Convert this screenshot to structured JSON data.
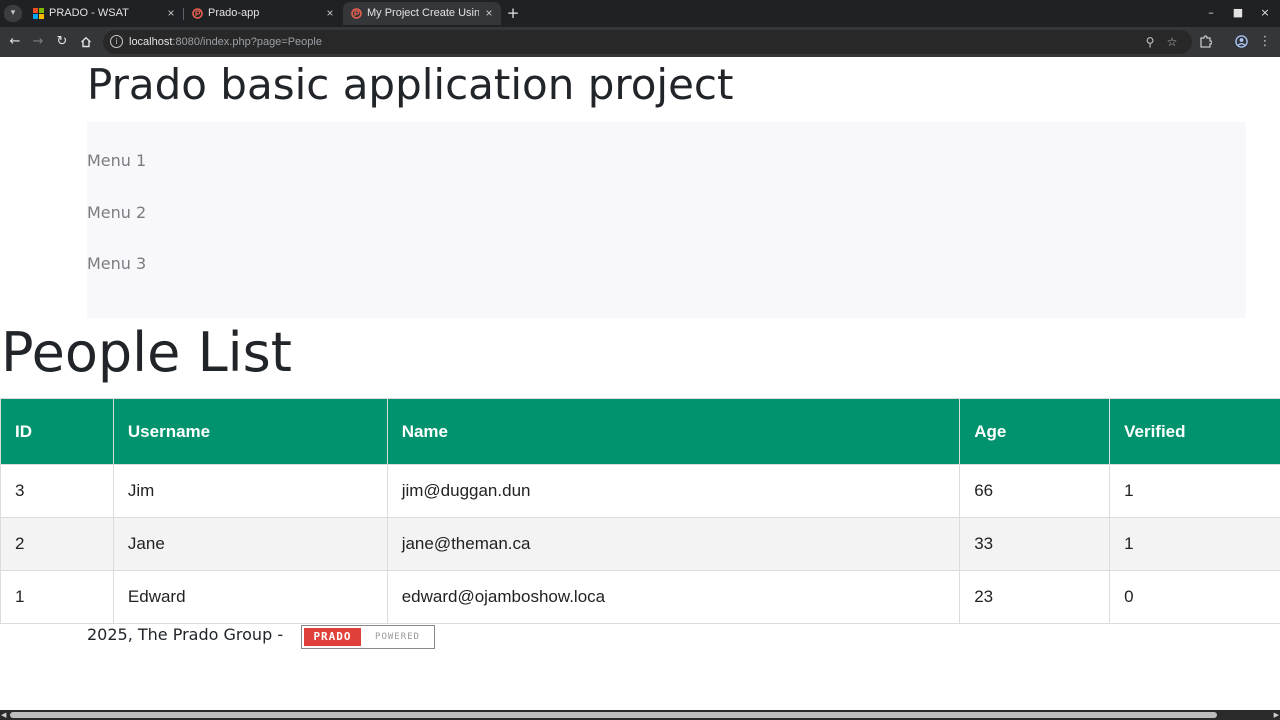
{
  "browser": {
    "tabs": [
      {
        "title": "PRADO - WSAT",
        "active": false
      },
      {
        "title": "Prado-app",
        "active": false
      },
      {
        "title": "My Project Create Usin",
        "active": true
      }
    ],
    "new_tab_symbol": "+",
    "url_host": "localhost",
    "url_rest": ":8080/index.php?page=People"
  },
  "header": {
    "title": "Prado basic application project"
  },
  "menu": {
    "items": [
      "Menu 1",
      "Menu 2",
      "Menu 3"
    ]
  },
  "main": {
    "title": "People List"
  },
  "table": {
    "columns": [
      "ID",
      "Username",
      "Name",
      "Age",
      "Verified"
    ],
    "rows": [
      [
        "3",
        "Jim",
        "jim@duggan.dun",
        "66",
        "1"
      ],
      [
        "2",
        "Jane",
        "jane@theman.ca",
        "33",
        "1"
      ],
      [
        "1",
        "Edward",
        "edward@ojamboshow.loca",
        "23",
        "0"
      ]
    ],
    "header_color": "#00936d"
  },
  "footer": {
    "text": "2025, The Prado Group -",
    "badge_left": "PRADO",
    "badge_right": "POWERED"
  },
  "icons": {
    "tab_list": "chevron-down-icon",
    "back": "back-arrow-icon",
    "forward": "forward-arrow-icon",
    "reload": "reload-icon",
    "home": "home-icon",
    "site_info": "info-icon",
    "zoom": "zoom-icon",
    "bookmark": "star-icon",
    "extensions": "puzzle-icon",
    "profile": "profile-icon",
    "menu": "kebab-menu-icon"
  }
}
